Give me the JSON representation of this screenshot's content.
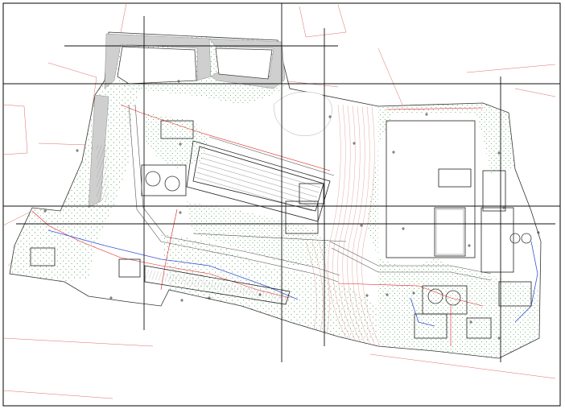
{
  "drawing": {
    "type": "site plan",
    "colors": {
      "frame": "#000000",
      "parcel_lines": "#e06b6b",
      "vegetation_dots": "#2f8f3a",
      "pipes_red": "#dd2222",
      "pipes_blue": "#3a55d8",
      "contours": "#d7857c",
      "embankment": "#cfcfcf"
    },
    "layers": [
      "parcel-boundaries",
      "vegetation",
      "contours",
      "roads",
      "buildings",
      "tanks",
      "basins",
      "utility-lines",
      "grid"
    ]
  }
}
